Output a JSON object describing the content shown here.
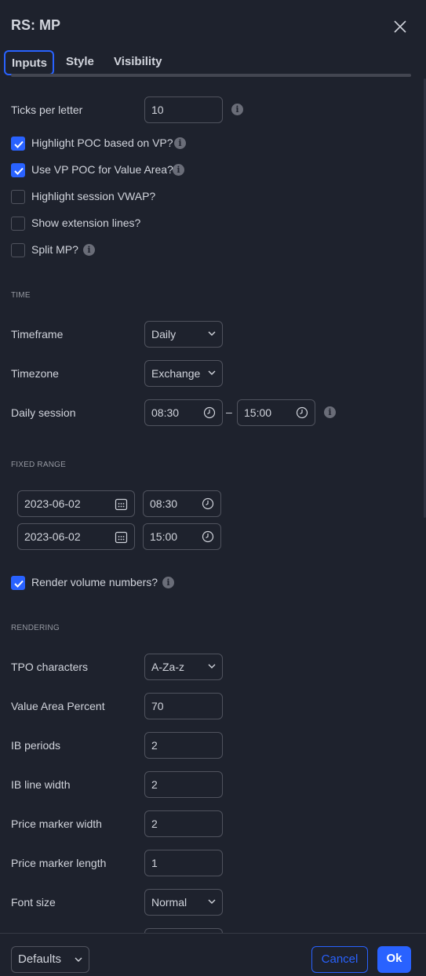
{
  "dialog": {
    "title": "RS: MP"
  },
  "tabs": [
    {
      "label": "Inputs",
      "active": true
    },
    {
      "label": "Style",
      "active": false
    },
    {
      "label": "Visibility",
      "active": false
    }
  ],
  "inputs": {
    "ticks_per_letter": {
      "label": "Ticks per letter",
      "value": "10"
    },
    "highlight_poc": {
      "label": "Highlight POC based on VP?",
      "checked": true
    },
    "use_vp_poc": {
      "label": "Use VP POC for Value Area?",
      "checked": true
    },
    "highlight_vwap": {
      "label": "Highlight session VWAP?",
      "checked": false
    },
    "show_extension": {
      "label": "Show extension lines?",
      "checked": false
    },
    "split_mp": {
      "label": "Split MP?",
      "checked": false
    }
  },
  "time": {
    "section_label": "TIME",
    "timeframe": {
      "label": "Timeframe",
      "value": "Daily"
    },
    "timezone": {
      "label": "Timezone",
      "value": "Exchange"
    },
    "daily_session": {
      "label": "Daily session",
      "start": "08:30",
      "end": "15:00",
      "separator": "–"
    }
  },
  "fixed_range": {
    "section_label": "FIXED RANGE",
    "start_date": "2023-06-02",
    "start_time": "08:30",
    "end_date": "2023-06-02",
    "end_time": "15:00",
    "render_volume": {
      "label": "Render volume numbers?",
      "checked": true
    }
  },
  "rendering": {
    "section_label": "RENDERING",
    "tpo_characters": {
      "label": "TPO characters",
      "value": "A-Za-z"
    },
    "value_area_percent": {
      "label": "Value Area Percent",
      "value": "70"
    },
    "ib_periods": {
      "label": "IB periods",
      "value": "2"
    },
    "ib_line_width": {
      "label": "IB line width",
      "value": "2"
    },
    "price_marker_width": {
      "label": "Price marker width",
      "value": "2"
    },
    "price_marker_length": {
      "label": "Price marker length",
      "value": "1"
    },
    "font_size": {
      "label": "Font size",
      "value": "Normal"
    }
  },
  "footer": {
    "defaults_label": "Defaults",
    "cancel_label": "Cancel",
    "ok_label": "Ok"
  },
  "colors": {
    "accent": "#2962ff",
    "background": "#1e222d",
    "text": "#d1d4dc",
    "border": "#50535e"
  },
  "icons": {
    "close": "close-icon",
    "info": "info-icon",
    "chevron": "chevron-down-icon",
    "clock": "clock-icon",
    "calendar": "calendar-icon",
    "check": "check-icon"
  }
}
